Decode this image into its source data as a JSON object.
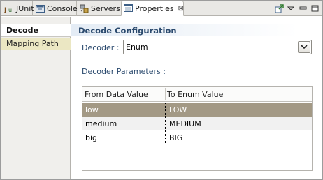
{
  "tabs": [
    {
      "label": "JUnit",
      "icon": "junit-icon",
      "active": false
    },
    {
      "label": "Console",
      "icon": "console-icon",
      "active": false
    },
    {
      "label": "Servers",
      "icon": "servers-icon",
      "active": false
    },
    {
      "label": "Properties",
      "icon": "properties-icon",
      "active": true,
      "close": "⊠"
    }
  ],
  "toolbar": {
    "icons": [
      "pin-view-icon",
      "view-menu-icon",
      "minimize-icon",
      "maximize-icon"
    ]
  },
  "leftnav": {
    "items": [
      {
        "label": "Decode",
        "selected": true
      },
      {
        "label": "Mapping Path",
        "selected": false
      }
    ]
  },
  "main": {
    "section_title": "Decode Configuration",
    "decoder_label": "Decoder :",
    "decoder_value": "Enum",
    "params_label": "Decoder Parameters :",
    "table": {
      "columns": [
        "From Data Value",
        "To Enum Value"
      ],
      "rows": [
        {
          "from": "low",
          "to": "LOW",
          "selected": true
        },
        {
          "from": "medium",
          "to": "MEDIUM",
          "selected": false
        },
        {
          "from": "big",
          "to": "BIG",
          "selected": false
        }
      ]
    }
  },
  "colors": {
    "accent_text": "#2b4a6e",
    "selection_row": "#a39985",
    "nav_item_bg": "#ebe7c3"
  }
}
